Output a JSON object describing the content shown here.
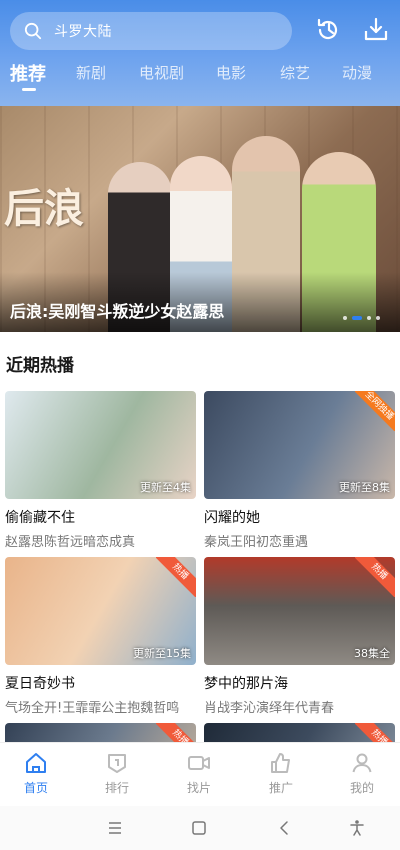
{
  "search": {
    "value": "斗罗大陆"
  },
  "header": {
    "tabs": [
      {
        "label": "推荐",
        "active": true
      },
      {
        "label": "新剧",
        "active": false
      },
      {
        "label": "电视剧",
        "active": false
      },
      {
        "label": "电影",
        "active": false
      },
      {
        "label": "综艺",
        "active": false
      },
      {
        "label": "动漫",
        "active": false
      }
    ],
    "icons": [
      "history-icon",
      "download-icon"
    ]
  },
  "banner": {
    "poster_title": "后浪",
    "caption": "后浪:吴刚智斗叛逆少女赵露思",
    "slide_count": 4,
    "active_slide": 2
  },
  "section": {
    "title": "近期热播"
  },
  "cards": [
    {
      "title": "偷偷藏不住",
      "desc": "赵露思陈哲远暗恋成真",
      "episodes": "更新至4集",
      "corner": "",
      "colors": [
        "#dfe9ee",
        "#9fb7a0",
        "#e8d3c6"
      ]
    },
    {
      "title": "闪耀的她",
      "desc": "秦岚王阳初恋重遇",
      "episodes": "更新至8集",
      "corner": "全网独播",
      "colors": [
        "#3c4a60",
        "#6a7d96",
        "#c9b7a9"
      ]
    },
    {
      "title": "夏日奇妙书",
      "desc": "气场全开!王霏霏公主抱魏哲鸣",
      "episodes": "更新至15集",
      "corner": "热播",
      "colors": [
        "#e9b48a",
        "#f2d2b3",
        "#8fb0cc"
      ]
    },
    {
      "title": "梦中的那片海",
      "desc": "肖战李沁演绎年代青春",
      "episodes": "38集全",
      "corner": "热播",
      "colors": [
        "#b23a2a",
        "#5e5a56",
        "#8f8a84"
      ]
    },
    {
      "title": "",
      "desc": "",
      "episodes": "",
      "corner": "热播",
      "colors": [
        "#334155",
        "#6b7a8d",
        "#b3a79a"
      ]
    },
    {
      "title": "",
      "desc": "",
      "episodes": "",
      "corner": "热播",
      "colors": [
        "#1f2a38",
        "#3d4b5e",
        "#7a8796"
      ]
    }
  ],
  "bottom_nav": [
    {
      "label": "首页",
      "icon": "home-icon",
      "active": true
    },
    {
      "label": "排行",
      "icon": "ranking-icon",
      "active": false
    },
    {
      "label": "找片",
      "icon": "video-icon",
      "active": false
    },
    {
      "label": "推广",
      "icon": "thumbs-up-icon",
      "active": false
    },
    {
      "label": "我的",
      "icon": "user-icon",
      "active": false
    }
  ],
  "system_nav": [
    "menu-icon",
    "home-square-icon",
    "back-icon",
    "accessibility-icon"
  ],
  "colors": {
    "accent": "#2f7ff0",
    "header_top": "#4a8de8",
    "inactive": "#999999"
  }
}
